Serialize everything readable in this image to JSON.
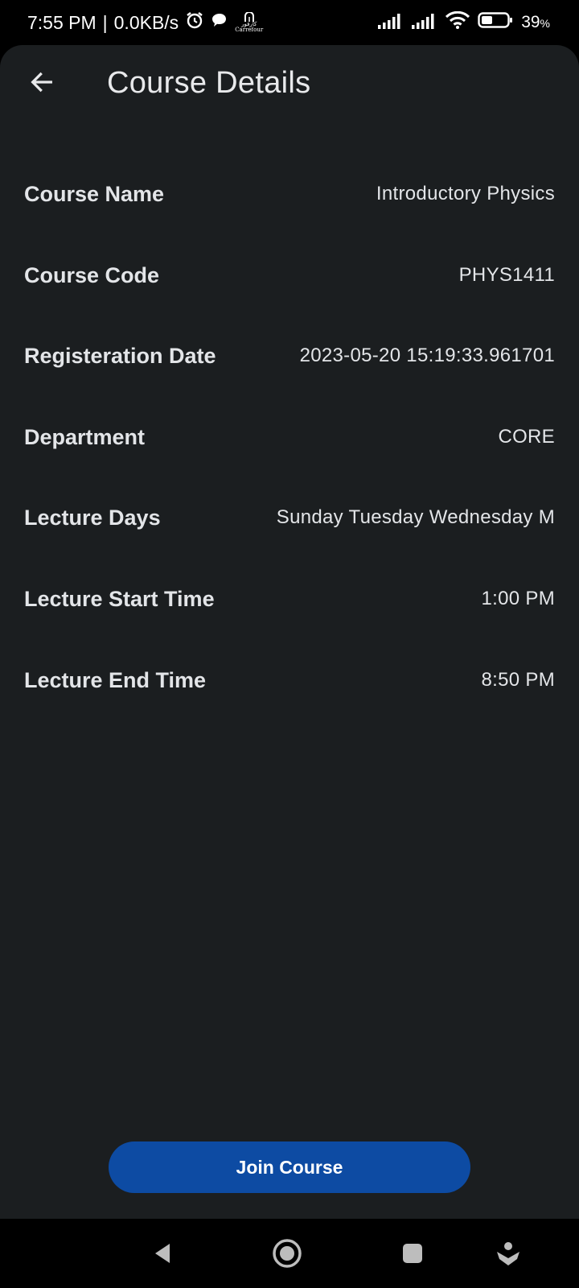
{
  "status_bar": {
    "time": "7:55 PM",
    "separator": "|",
    "net_speed": "0.0KB/s",
    "brand_arabic": "كارفور",
    "brand_latin": "Carrefour",
    "battery": "39",
    "battery_unit": "%"
  },
  "app_bar": {
    "title": "Course Details"
  },
  "details": [
    {
      "label": "Course Name",
      "value": "Introductory Physics"
    },
    {
      "label": "Course Code",
      "value": "PHYS1411"
    },
    {
      "label": "Registeration Date",
      "value": "2023-05-20 15:19:33.961701"
    },
    {
      "label": "Department",
      "value": "CORE"
    },
    {
      "label": "Lecture Days",
      "value": "Sunday Tuesday Wednesday M"
    },
    {
      "label": "Lecture Start Time",
      "value": "1:00 PM"
    },
    {
      "label": "Lecture End Time",
      "value": "8:50 PM"
    }
  ],
  "actions": {
    "join_label": "Join Course"
  },
  "colors": {
    "background": "#1b1e20",
    "accent": "#0d4ba3",
    "text": "#e3e5e8"
  },
  "icons": {
    "back": "arrow-left-icon",
    "alarm": "alarm-clock-icon",
    "chat": "chat-bubble-icon",
    "signal": "signal-bars-icon",
    "wifi": "wifi-icon",
    "battery": "battery-icon",
    "nav_back": "triangle-back-icon",
    "nav_home": "circle-home-icon",
    "nav_recents": "square-recents-icon",
    "nav_assist": "assistant-icon"
  }
}
